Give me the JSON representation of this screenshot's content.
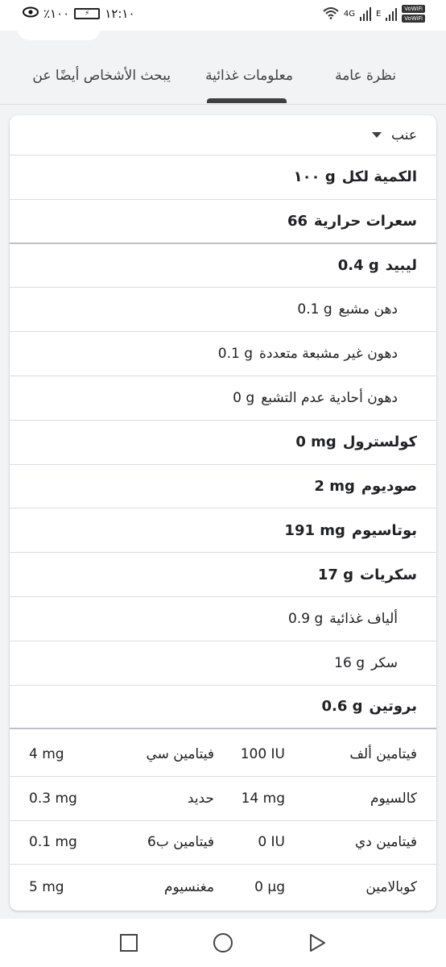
{
  "status": {
    "time": "١٢:١٠",
    "battery": "٪١٠٠",
    "net": "4G",
    "net2": "E",
    "vowifi1": "VoWiFi",
    "vowifi2": "VoWiFi"
  },
  "tabs": [
    {
      "label": "نظرة عامة"
    },
    {
      "label": "معلومات غذائية"
    },
    {
      "label": "يبحث الأشخاص أيضًا عن"
    }
  ],
  "dropdown": {
    "selected": "عنب"
  },
  "nutrition": {
    "serving": {
      "label": "الكمية لكل",
      "value": "١٠٠ g"
    },
    "calories": {
      "label": "سعرات حرارية",
      "value": "66"
    },
    "fat": {
      "label": "ليبيد",
      "value": "0.4 g"
    },
    "sat_fat": {
      "label": "دهن مشبع",
      "value": "0.1 g"
    },
    "poly_fat": {
      "label": "دهون غير مشبعة متعددة",
      "value": "0.1 g"
    },
    "mono_fat": {
      "label": "دهون أحادية عدم التشبع",
      "value": "0 g"
    },
    "cholesterol": {
      "label": "كولسترول",
      "value": "0 mg"
    },
    "sodium": {
      "label": "صوديوم",
      "value": "2 mg"
    },
    "potassium": {
      "label": "بوتاسيوم",
      "value": "191 mg"
    },
    "carbs": {
      "label": "سكريات",
      "value": "17 g"
    },
    "fiber": {
      "label": "ألياف غذائية",
      "value": "0.9 g"
    },
    "sugar": {
      "label": "سكر",
      "value": "16 g"
    },
    "protein": {
      "label": "بروتين",
      "value": "0.6 g"
    }
  },
  "vitamins": [
    {
      "l1": "فيتامين ألف",
      "v1": "100 IU",
      "l2": "فيتامين سي",
      "v2": "4 mg"
    },
    {
      "l1": "كالسيوم",
      "v1": "14 mg",
      "l2": "حديد",
      "v2": "0.3 mg"
    },
    {
      "l1": "فيتامين دي",
      "v1": "0 IU",
      "l2": "فيتامين ب6",
      "v2": "0.1 mg"
    },
    {
      "l1": "كوبالامين",
      "v1": "0 µg",
      "l2": "مغنسيوم",
      "v2": "5 mg"
    }
  ]
}
